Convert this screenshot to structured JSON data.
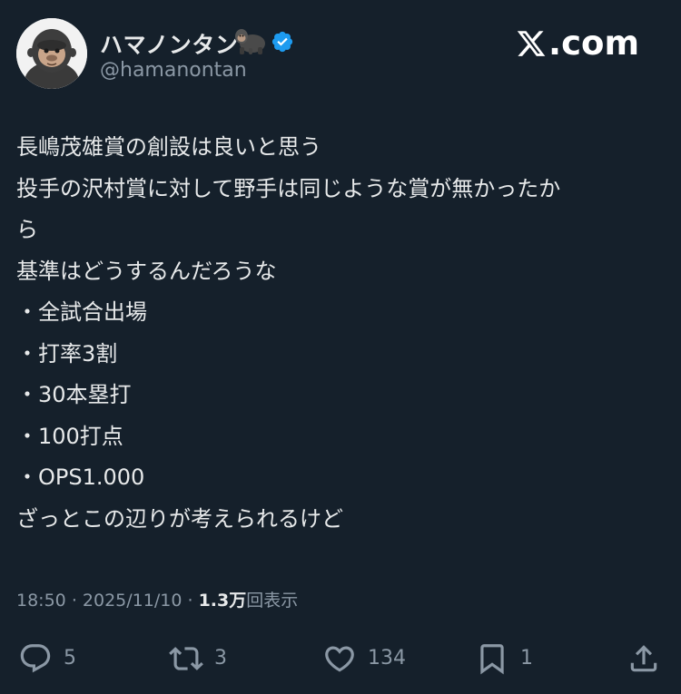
{
  "header": {
    "display_name": "ハマノンタン",
    "name_emoji": "gorilla-emoji",
    "verified_badge": "verified-badge-icon",
    "handle": "@hamanontan",
    "brand": ".com",
    "brand_icon": "x-logo-icon"
  },
  "tweet": {
    "lines": [
      "長嶋茂雄賞の創設は良いと思う",
      "投手の沢村賞に対して野手は同じような賞が無かったか",
      "ら",
      "基準はどうするんだろうな",
      "・全試合出場",
      "・打率3割",
      "・30本塁打",
      "・100打点",
      "・OPS1.000",
      "ざっとこの辺りが考えられるけど"
    ]
  },
  "meta": {
    "time": "18:50",
    "date": "2025/11/10",
    "views_count": "1.3万",
    "views_label": "回表示",
    "separator": "·"
  },
  "actions": {
    "reply": {
      "icon": "reply-icon",
      "count": "5"
    },
    "repost": {
      "icon": "repost-icon",
      "count": "3"
    },
    "like": {
      "icon": "heart-icon",
      "count": "134"
    },
    "bookmark": {
      "icon": "bookmark-icon",
      "count": "1"
    },
    "share": {
      "icon": "share-icon"
    }
  },
  "colors": {
    "background": "#15202b",
    "text": "#e7e9ea",
    "secondary": "#8b98a5",
    "verified": "#1d9bf0"
  }
}
